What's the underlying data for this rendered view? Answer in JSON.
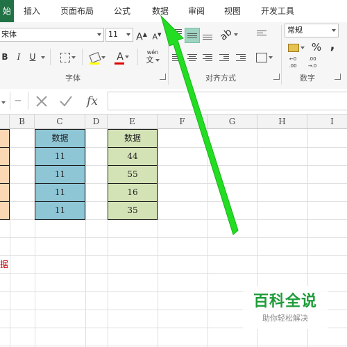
{
  "ribbon_tabs": [
    "始",
    "插入",
    "页面布局",
    "公式",
    "数据",
    "审阅",
    "视图",
    "开发工具"
  ],
  "active_tab": "始",
  "highlighted_tab": "数据",
  "font": {
    "name": "宋体",
    "size": "11",
    "bold": "B",
    "italic": "I",
    "underline": "U",
    "grow_glyph": "A",
    "shrink_glyph": "A",
    "font_color_glyph": "A",
    "phonetic_top": "wén",
    "phonetic_bottom": "文",
    "group_label": "字体"
  },
  "alignment": {
    "group_label": "对齐方式"
  },
  "number": {
    "format": "常规",
    "percent": "%",
    "comma": ",",
    "inc_decimal_top": "←0",
    "inc_decimal_bottom": ".00",
    "dec_decimal_top": ".00",
    "dec_decimal_bottom": "→.0",
    "group_label": "数字"
  },
  "formula_bar": {
    "fx": "fx",
    "value": ""
  },
  "columns": [
    "B",
    "C",
    "D",
    "E",
    "F",
    "G",
    "H",
    "I"
  ],
  "table_c": {
    "header": "数据",
    "values": [
      "11",
      "11",
      "11",
      "11"
    ]
  },
  "table_e": {
    "header": "数据",
    "values": [
      "44",
      "55",
      "16",
      "35"
    ]
  },
  "partial_a_text": "据",
  "watermark": {
    "title": "百科全说",
    "subtitle": "助你轻松解决"
  },
  "colors": {
    "tab_active": "#217346",
    "cell_blue": "#8ec6d6",
    "cell_green": "#d4e3b6",
    "cell_orange": "#fbd7b4",
    "arrow": "#22dd22",
    "partial_text": "#c00000",
    "watermark_text": "#1f9c3a"
  }
}
